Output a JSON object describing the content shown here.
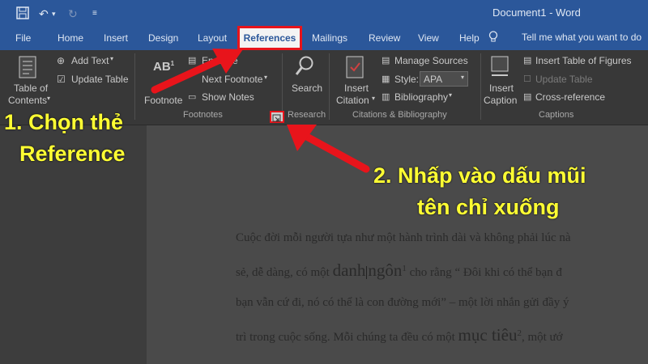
{
  "titlebar": {
    "document_title": "Document1 - Word"
  },
  "tabs": [
    "File",
    "Home",
    "Insert",
    "Design",
    "Layout",
    "References",
    "Mailings",
    "Review",
    "View",
    "Help"
  ],
  "tell_me": "Tell me what you want to do",
  "ribbon": {
    "toc": {
      "label1": "Table of",
      "label2": "Contents",
      "add_text": "Add Text",
      "update_table": "Update Table"
    },
    "footnotes": {
      "ab_icon": "AB",
      "insert_endnote": "Endnote",
      "next_footnote": "Next Footnote",
      "show_notes": "Show Notes",
      "insert_footnote_2": "Footnote",
      "group": "Footnotes"
    },
    "research": {
      "search": "Search",
      "group": "Research"
    },
    "citations": {
      "insert1": "Insert",
      "insert2": "Citation",
      "manage_sources": "Manage Sources",
      "style_label": "Style:",
      "style_value": "APA",
      "bibliography": "Bibliography",
      "group": "Citations & Bibliography"
    },
    "captions": {
      "insert1": "Insert",
      "insert2": "Caption",
      "insert_table_figures": "Insert Table of Figures",
      "update_table": "Update Table",
      "cross_reference": "Cross-reference",
      "group": "Captions"
    }
  },
  "document": {
    "line1": "Cuộc đời mỗi người tựa như một hành trình dài và không phải lúc nà",
    "line2a": "sẻ, dễ dàng, có một",
    "line2b": "danh",
    "line2c": "ngôn",
    "line2d": "cho rằng “ Đôi khi có thể bạn đ",
    "line3": "bạn vẫn cứ đi, nó có thể là con đường mới” – một lời nhắn gửi đầy ý",
    "line4a": "trì trong cuộc sống. Mỗi chúng ta đều có một",
    "line4b": "mục tiêu",
    "line4c": ", một ướ"
  },
  "annotations": {
    "step1_line1": "1. Chọn thẻ",
    "step1_line2": "Reference",
    "step2_line1": "2. Nhấp vào dấu mũi",
    "step2_line2": "tên chỉ xuống"
  },
  "colors": {
    "word_blue": "#2b579a",
    "highlight_red": "#e8141b",
    "annotation_yellow": "#ffff33"
  }
}
